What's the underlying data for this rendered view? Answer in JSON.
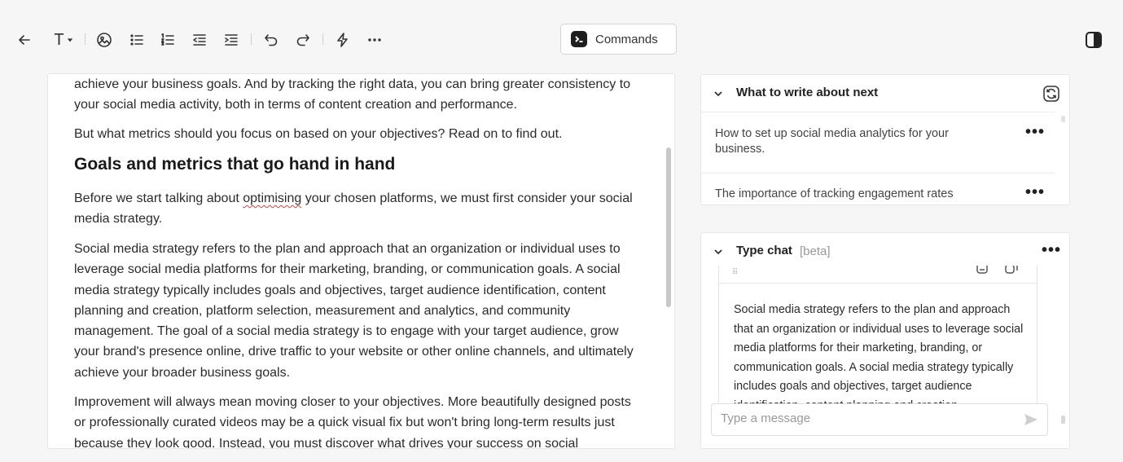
{
  "toolbar": {
    "icons": [
      "back-arrow-icon",
      "text-style-icon",
      "image-icon",
      "bullet-list-icon",
      "numbered-list-icon",
      "outdent-icon",
      "indent-icon",
      "undo-icon",
      "redo-icon",
      "lightning-icon",
      "more-icon"
    ],
    "commands_label": "Commands",
    "text_style_glyph": "T"
  },
  "editor": {
    "paragraph_1": "achieve your business goals. And by tracking the right data, you can bring greater consistency to your social media activity, both in terms of content creation and performance.",
    "paragraph_2": "But what metrics should you focus on based on your objectives? Read on to find out.",
    "heading": "Goals and metrics that go hand in hand",
    "paragraph_3_before": "Before we start talking about ",
    "paragraph_3_misspelled": "optimising",
    "paragraph_3_after": " your chosen platforms, we must first consider your social media strategy.",
    "paragraph_4": "Social media strategy refers to the plan and approach that an organization or individual uses to leverage social media platforms for their marketing, branding, or communication goals. A social media strategy typically includes goals and objectives, target audience identification, content planning and creation, platform selection, measurement and analytics, and community management. The goal of a social media strategy is to engage with your target audience, grow your brand's presence online, drive traffic to your website or other online channels, and ultimately achieve your broader business goals.",
    "paragraph_5": "Improvement will always mean moving closer to your objectives. More beautifully designed posts or professionally curated videos may be a quick visual fix but won't bring long-term results just because they look good. Instead, you must discover what drives your success on social"
  },
  "what_next": {
    "title": "What to write about next",
    "suggestions": [
      {
        "text": "How to set up social media analytics for your business.",
        "menu": "•••"
      },
      {
        "text": "The importance of tracking engagement rates",
        "menu": "•••"
      }
    ]
  },
  "type_chat": {
    "title": "Type chat",
    "badge": "[beta]",
    "menu": "•••",
    "grip": "⠿",
    "message": "Social media strategy refers to the plan and approach that an organization or individual uses to leverage social media platforms for their marketing, branding, or communication goals. A social media strategy typically includes goals and objectives, target audience identification, content planning and creation",
    "input_placeholder": "Type a message"
  },
  "colors": {
    "background": "#f6f6f6",
    "surface": "#ffffff",
    "text": "#2b2b2b",
    "spellcheck": "#e04040",
    "badge": "#1e1e1e"
  }
}
